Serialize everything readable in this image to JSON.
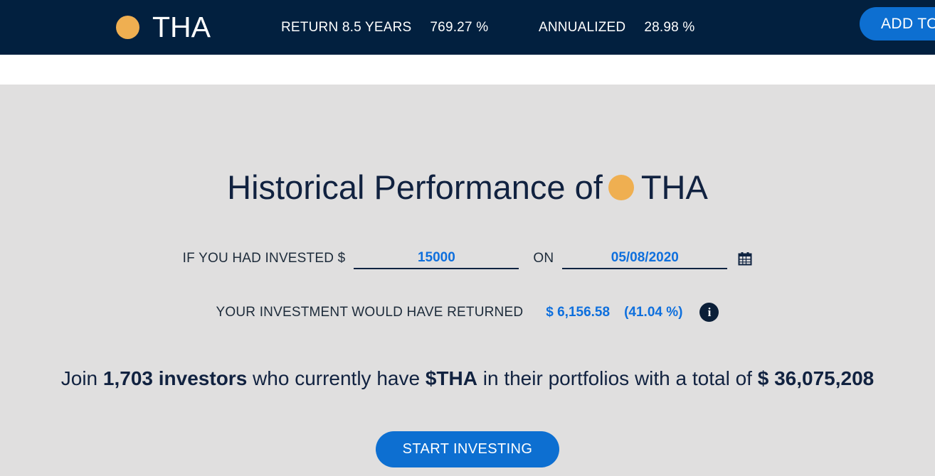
{
  "header": {
    "coin_dot_color": "#efaf51",
    "ticker": "THA",
    "return_label": "RETURN 8.5 YEARS",
    "return_value": "769.27 %",
    "annualized_label": "ANNUALIZED",
    "annualized_value": "28.98 %",
    "add_to_button": "ADD TO",
    "bar_color": "#02203f",
    "button_color": "#0d6fd1"
  },
  "main": {
    "title_prefix": "Historical Performance of",
    "title_ticker": "THA",
    "invest": {
      "prefix_label": "IF YOU HAD INVESTED $",
      "amount_value": "15000",
      "amount_placeholder": "15000",
      "on_label": "ON",
      "date_value": "05/08/2020",
      "date_placeholder": "05/08/2020",
      "calendar_icon": "calendar-icon"
    },
    "returned": {
      "label": "YOUR INVESTMENT WOULD HAVE RETURNED",
      "amount": "$ 6,156.58",
      "percent": "(41.04 %)",
      "info_icon": "i"
    },
    "join": {
      "part1": "Join ",
      "investors_count": "1,703 investors",
      "part2": " who currently have ",
      "ticker_symbol": "$THA",
      "part3": " in their portfolios with a total of ",
      "total_value": "$ 36,075,208"
    },
    "start_button": "START INVESTING",
    "background_color": "#e0dfdf",
    "accent_color": "#0e6fdd",
    "text_color": "#112240"
  }
}
